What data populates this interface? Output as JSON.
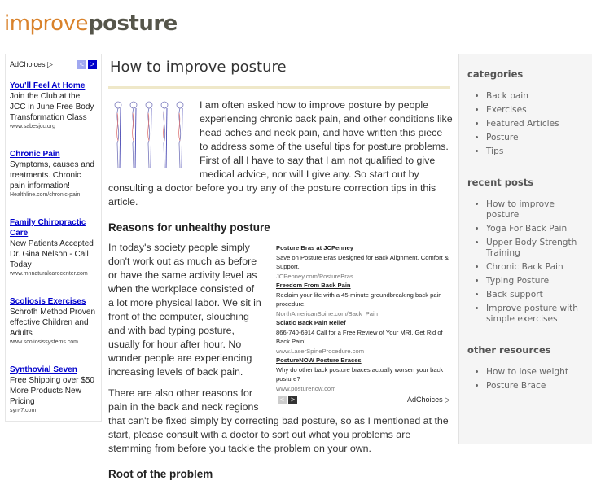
{
  "logo": {
    "part1": "improve",
    "part2": "posture"
  },
  "left_ads": {
    "adchoices": "AdChoices ▷",
    "items": [
      {
        "title": "You'll Feel At Home",
        "text": "Join the Club at the JCC in June Free Body Transformation Class",
        "url": "www.sabesjcc.org"
      },
      {
        "title": "Chronic Pain",
        "text": "Symptoms, causes and treatments. Chronic pain information!",
        "url": "Healthline.com/chronic-pain"
      },
      {
        "title": "Family Chiropractic Care",
        "text": "New Patients Accepted Dr. Gina Nelson - Call Today",
        "url": "www.mnnaturalcarecenter.com"
      },
      {
        "title": "Scoliosis Exercises",
        "text": "Schroth Method Proven effective Children and Adults",
        "url": "www.scoliosissystems.com"
      },
      {
        "title": "Synthovial Seven",
        "text": "Free Shipping over $50 More Products New Pricing",
        "url": "syn-7.com"
      }
    ]
  },
  "article": {
    "title": "How to improve posture",
    "intro": "I am often asked how to improve posture by people experiencing chronic back pain, and other conditions like head aches and neck pain, and have written this piece to address some of the useful tips for posture problems. First of all I have to say that I am not qualified to give medical advice, nor will I give any. So start out by consulting a doctor before you try any of the posture correction tips in this article.",
    "h2_1": "Reasons for unhealthy posture",
    "p1": "In today's society people simply don't work out as much as before or have the same activity level as when the workplace consisted of a lot more physical labor. We sit in front of the computer, slouching and with bad typing posture, usually for hour after hour. No wonder people are experiencing increasing levels of back pain.",
    "p2": "There are also other reasons for pain in the back and neck regions that can't be fixed simply by correcting bad posture, so as I mentioned at the start, please consult with a doctor to sort out what you problems are stemming from before you tackle the problem on your own.",
    "h2_2": "Root of the problem"
  },
  "inline_ads": {
    "adchoices": "AdChoices ▷",
    "items": [
      {
        "title": "Posture Bras at JCPenney",
        "text": "Save on Posture Bras Designed for Back Alignment. Comfort & Support.",
        "url": "JCPenney.com/PostureBras"
      },
      {
        "title": "Freedom From Back Pain",
        "text": "Reclaim your life with a 45-minute groundbreaking back pain procedure.",
        "url": "NorthAmericanSpine.com/Back_Pain"
      },
      {
        "title": "Sciatic Back Pain Relief",
        "text": "866-740-6914 Call for a Free Review of Your MRI. Get Rid of Back Pain!",
        "url": "www.LaserSpineProcedure.com"
      },
      {
        "title": "PostureNOW Posture Braces",
        "text": "Why do other back posture braces actually worsen your back posture?",
        "url": "www.posturenow.com"
      }
    ]
  },
  "sidebar": {
    "categories_title": "categories",
    "categories": [
      "Back pain",
      "Exercises",
      "Featured Articles",
      "Posture",
      "Tips"
    ],
    "recent_title": "recent posts",
    "recent": [
      "How to improve posture",
      "Yoga For Back Pain",
      "Upper Body Strength Training",
      "Chronic Back Pain",
      "Typing Posture",
      "Back support",
      "Improve posture with simple exercises"
    ],
    "other_title": "other resources",
    "other": [
      "How to lose weight",
      "Posture Brace"
    ]
  },
  "colors": {
    "logo_orange": "#d9822b",
    "logo_dark": "#55554a",
    "ad_link": "#0000cc",
    "rule": "#efe8c9"
  }
}
